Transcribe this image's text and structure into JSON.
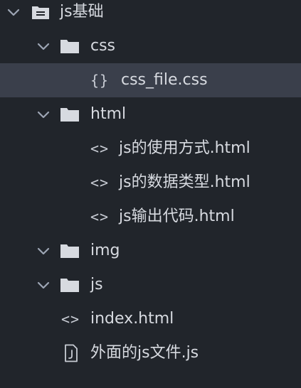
{
  "tree": {
    "root": {
      "label": "js基础",
      "icon": "folder-open-icon",
      "expanded": true
    },
    "folders": {
      "css": {
        "label": "css",
        "expanded": true,
        "files": [
          {
            "label": "css_file.css",
            "icon_text": "{}",
            "icon": "css-braces-icon",
            "selected": true
          }
        ]
      },
      "html": {
        "label": "html",
        "expanded": true,
        "files": [
          {
            "label": "js的使用方式.html",
            "icon_text": "<>",
            "icon": "code-icon"
          },
          {
            "label": "js的数据类型.html",
            "icon_text": "<>",
            "icon": "code-icon"
          },
          {
            "label": "js输出代码.html",
            "icon_text": "<>",
            "icon": "code-icon"
          }
        ]
      },
      "img": {
        "label": "img",
        "expanded": true
      },
      "js": {
        "label": "js",
        "expanded": true
      }
    },
    "root_files": [
      {
        "label": "index.html",
        "icon_text": "<>",
        "icon": "code-icon"
      },
      {
        "label": "外面的js文件.js",
        "icon": "js-file-icon"
      }
    ]
  },
  "colors": {
    "background": "#21252b",
    "selected_row": "#3a3f4b",
    "text": "#d7dae0",
    "icon": "#9da5b4"
  }
}
